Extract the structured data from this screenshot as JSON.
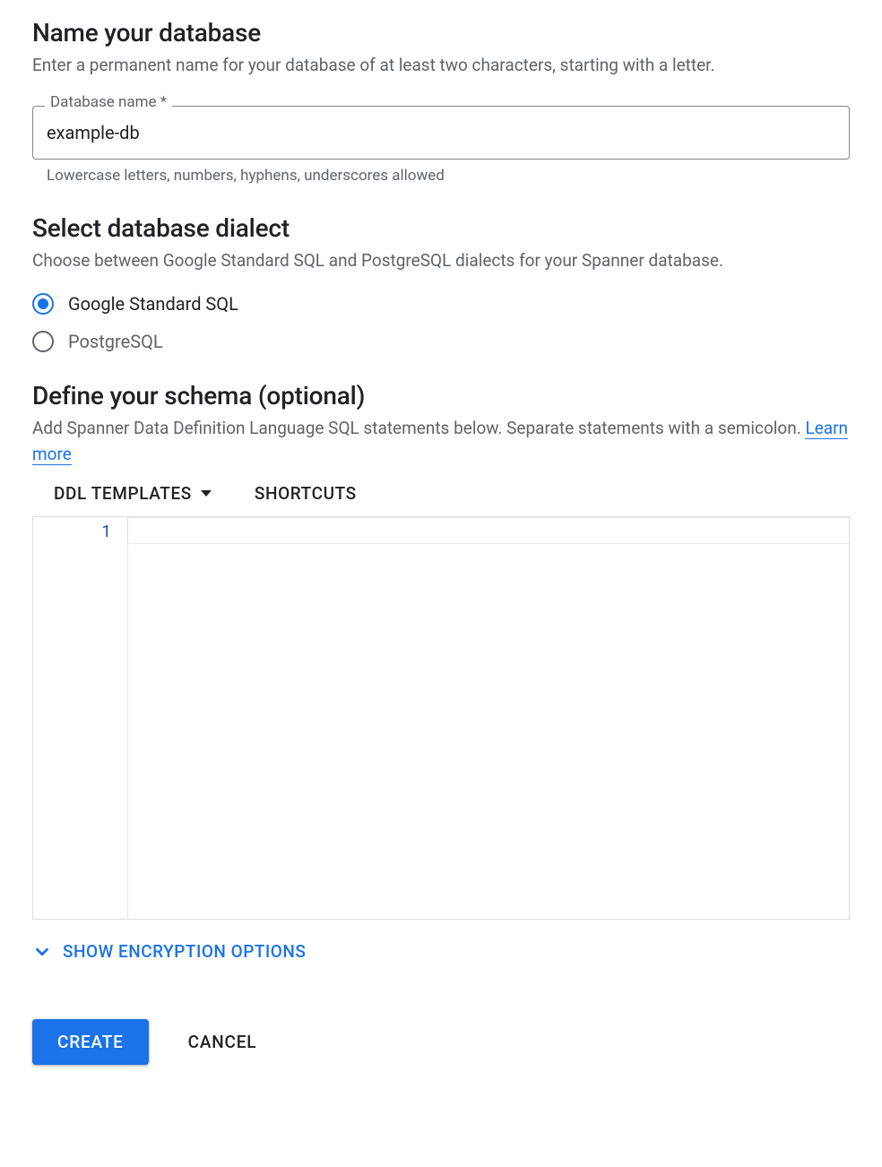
{
  "name_section": {
    "title": "Name your database",
    "desc": "Enter a permanent name for your database of at least two characters, starting with a letter.",
    "field_label": "Database name *",
    "field_value": "example-db",
    "field_hint": "Lowercase letters, numbers, hyphens, underscores allowed"
  },
  "dialect_section": {
    "title": "Select database dialect",
    "desc": "Choose between Google Standard SQL and PostgreSQL dialects for your Spanner database.",
    "options": [
      {
        "label": "Google Standard SQL",
        "selected": true
      },
      {
        "label": "PostgreSQL",
        "selected": false
      }
    ]
  },
  "schema_section": {
    "title": "Define your schema (optional)",
    "desc_prefix": "Add Spanner Data Definition Language SQL statements below. Separate statements with a semicolon. ",
    "learn_more": "Learn more",
    "toolbar": {
      "ddl_templates": "DDL TEMPLATES",
      "shortcuts": "SHORTCUTS"
    },
    "editor": {
      "line_number": "1",
      "content": ""
    }
  },
  "encryption_toggle": "SHOW ENCRYPTION OPTIONS",
  "actions": {
    "create": "CREATE",
    "cancel": "CANCEL"
  }
}
